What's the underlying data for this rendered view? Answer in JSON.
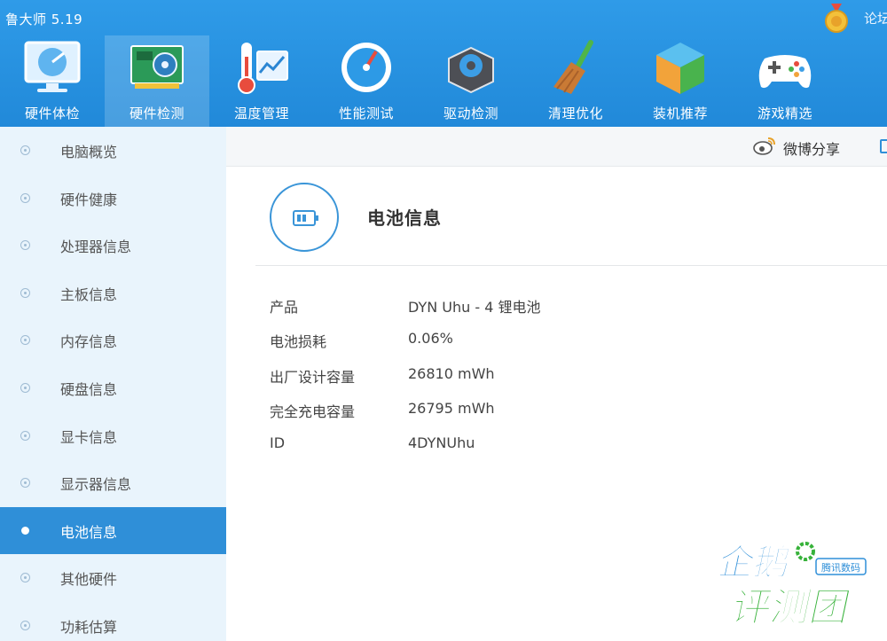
{
  "window": {
    "title": "鲁大师 5.19",
    "forum_link": "论坛"
  },
  "nav": {
    "items": [
      {
        "label": "硬件体检",
        "icon": "monitor-radar-icon"
      },
      {
        "label": "硬件检测",
        "icon": "circuit-board-icon",
        "active": true
      },
      {
        "label": "温度管理",
        "icon": "thermometer-icon"
      },
      {
        "label": "性能测试",
        "icon": "speedometer-icon"
      },
      {
        "label": "驱动检测",
        "icon": "gear-box-icon"
      },
      {
        "label": "清理优化",
        "icon": "broom-icon"
      },
      {
        "label": "装机推荐",
        "icon": "cube-icon"
      },
      {
        "label": "游戏精选",
        "icon": "gamepad-icon"
      }
    ]
  },
  "sidebar": {
    "items": [
      {
        "label": "电脑概览"
      },
      {
        "label": "硬件健康"
      },
      {
        "label": "处理器信息"
      },
      {
        "label": "主板信息"
      },
      {
        "label": "内存信息"
      },
      {
        "label": "硬盘信息"
      },
      {
        "label": "显卡信息"
      },
      {
        "label": "显示器信息"
      },
      {
        "label": "电池信息",
        "active": true
      },
      {
        "label": "其他硬件"
      },
      {
        "label": "功耗估算"
      }
    ]
  },
  "share": {
    "weibo_label": "微博分享"
  },
  "section": {
    "title": "电池信息",
    "icon": "battery-icon",
    "rows": [
      {
        "key": "产品",
        "value": "DYN Uhu - 4 锂电池"
      },
      {
        "key": "电池损耗",
        "value": "0.06%"
      },
      {
        "key": "出厂设计容量",
        "value": "26810 mWh"
      },
      {
        "key": "完全充电容量",
        "value": "26795 mWh"
      },
      {
        "key": "ID",
        "value": "4DYNUhu"
      }
    ]
  },
  "colors": {
    "header": "#2189d9",
    "sidebar_bg": "#e9f4fc",
    "active": "#2f8fd8",
    "watermark_green": "#37b23a",
    "watermark_blue": "#2f8fd8"
  }
}
